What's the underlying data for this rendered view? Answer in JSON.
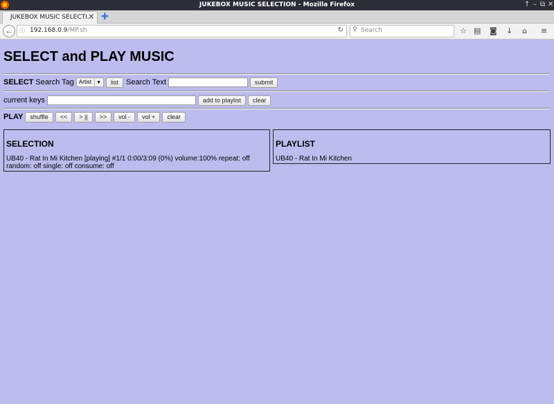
{
  "browser": {
    "window_title": "JUKEBOX MUSIC SELECTION - Mozilla Firefox",
    "tab_title": "JUKEBOX MUSIC SELECTI...",
    "url_host": "192.168.0.9",
    "url_path": "/MP.sh",
    "search_placeholder": "Search",
    "controls": [
      "↑",
      "–",
      "⧉",
      "✕"
    ]
  },
  "page": {
    "heading": "SELECT and PLAY MUSIC",
    "select_row": {
      "label_bold": "SELECT",
      "search_tag_label": "Search Tag",
      "tag_value": "Artist",
      "list_button": "list",
      "search_text_label": "Search Text",
      "search_text_value": "",
      "submit_button": "submit"
    },
    "keys_row": {
      "label": "current keys",
      "value": "",
      "add_button": "add to playlist",
      "clear_button": "clear"
    },
    "play_row": {
      "label_bold": "PLAY",
      "buttons": [
        "shuffle",
        "<<",
        "> ||",
        ">>",
        "vol -",
        "vol +",
        "clear"
      ]
    },
    "selection": {
      "title": "SELECTION",
      "status_line1": "UB40 - Rat In Mi Kitchen [playing] #1/1 0:00/3:09 (0%) volume:100% repeat: off",
      "status_line2": "random: off single: off consume: off"
    },
    "playlist": {
      "title": "PLAYLIST",
      "items": [
        "UB40 - Rat In Mi Kitchen"
      ]
    }
  }
}
